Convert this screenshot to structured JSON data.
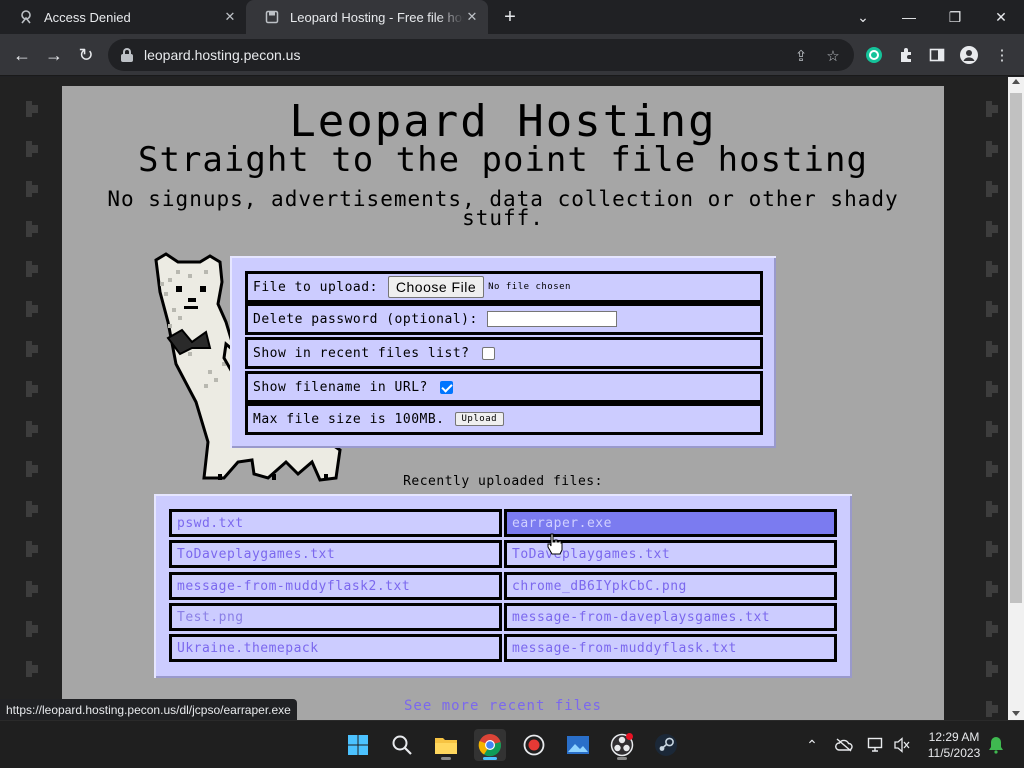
{
  "browser": {
    "tabs": [
      {
        "title": "Access Denied",
        "icon": "page-icon",
        "active": false
      },
      {
        "title": "Leopard Hosting - Free file hosting",
        "icon": "page-icon",
        "active": true
      }
    ],
    "url": "leopard.hosting.pecon.us",
    "status_url": "https://leopard.hosting.pecon.us/dl/jcpso/earraper.exe"
  },
  "site": {
    "title": "Leopard Hosting",
    "subtitle": "Straight to the point file hosting",
    "tagline": "No signups, advertisements, data collection or other shady stuff."
  },
  "upload_form": {
    "file_label": "File to upload:",
    "choose_file_label": "Choose File",
    "no_file_text": "No file chosen",
    "delete_password_label": "Delete password (optional):",
    "delete_password_value": "",
    "show_recent_label": "Show in recent files list?",
    "show_recent_checked": false,
    "show_filename_label": "Show filename in URL?",
    "show_filename_checked": true,
    "max_size_label": "Max file size is 100MB.",
    "upload_label": "Upload"
  },
  "recent": {
    "heading": "Recently uploaded files:",
    "files": [
      "pswd.txt",
      "earraper.exe",
      "ToDaveplaygames.txt",
      "ToDaveplaygames.txt",
      "message-from-muddyflask2.txt",
      "chrome_dB6IYpkCbC.png",
      "Test.png",
      "message-from-daveplaysgames.txt",
      "Ukraine.themepack",
      "message-from-muddyflask.txt"
    ],
    "see_more": "See more recent files"
  },
  "taskbar": {
    "apps": [
      "start-icon",
      "search-icon",
      "file-explorer-icon",
      "chrome-icon",
      "record-icon",
      "photos-icon",
      "obs-icon",
      "steam-icon"
    ],
    "time": "12:29 AM",
    "date": "11/5/2023"
  },
  "colors": {
    "panel": "#ccccff",
    "page_bg": "#a6a6a6",
    "link": "#7b68ee",
    "hover_cell": "#7b7bf0"
  }
}
